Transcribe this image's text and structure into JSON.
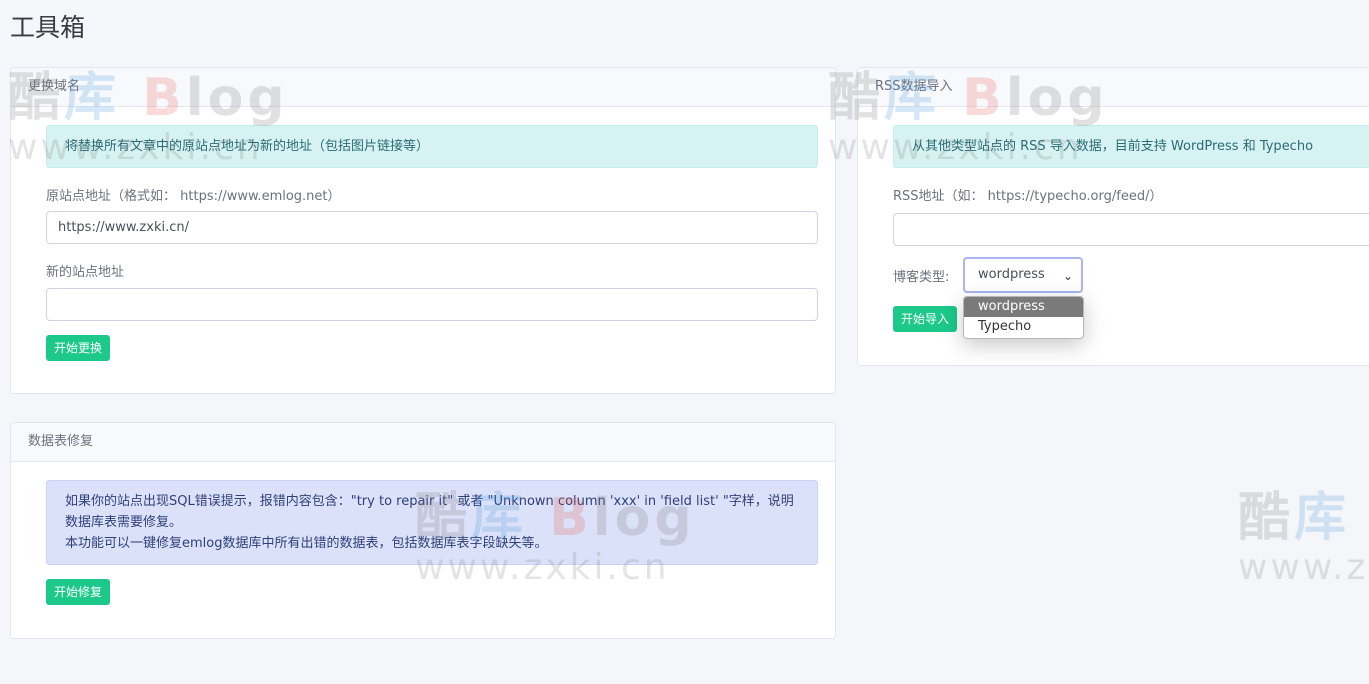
{
  "page": {
    "title": "工具箱"
  },
  "domain_card": {
    "header": "更换域名",
    "alert": "将替换所有文章中的原站点地址为新的地址（包括图片链接等）",
    "old_label": "原站点地址（格式如： https://www.emlog.net）",
    "old_value": "https://www.zxki.cn/",
    "new_label": "新的站点地址",
    "new_value": "",
    "button": "开始更换"
  },
  "rss_card": {
    "header": "RSS数据导入",
    "alert": "从其他类型站点的 RSS 导入数据，目前支持 WordPress 和 Typecho",
    "url_label": "RSS地址（如： https://typecho.org/feed/）",
    "url_value": "",
    "type_label": "博客类型:",
    "type_selected": "wordpress",
    "type_options": [
      "wordpress",
      "Typecho"
    ],
    "button": "开始导入"
  },
  "repair_card": {
    "header": "数据表修复",
    "alert_line1": "如果你的站点出现SQL错误提示，报错内容包含：\"try to repair it\" 或者 \"Unknown column 'xxx' in 'field list' \"字样，说明",
    "alert_line2": "数据库表需要修复。",
    "alert_line3": "本功能可以一键修复emlog数据库中所有出错的数据表，包括数据库表字段缺失等。",
    "button": "开始修复"
  },
  "watermark": {
    "cn1": "酷",
    "cn2": "库",
    "blog_b": "B",
    "blog_rest": "log",
    "url": "www.zxki.cn",
    "url_partial": "www.z"
  },
  "colors": {
    "accent_green": "#1cc88a",
    "info_bg": "#d6f2f2",
    "primary_bg": "#dbe1f8",
    "page_bg": "#f5f6fa"
  }
}
